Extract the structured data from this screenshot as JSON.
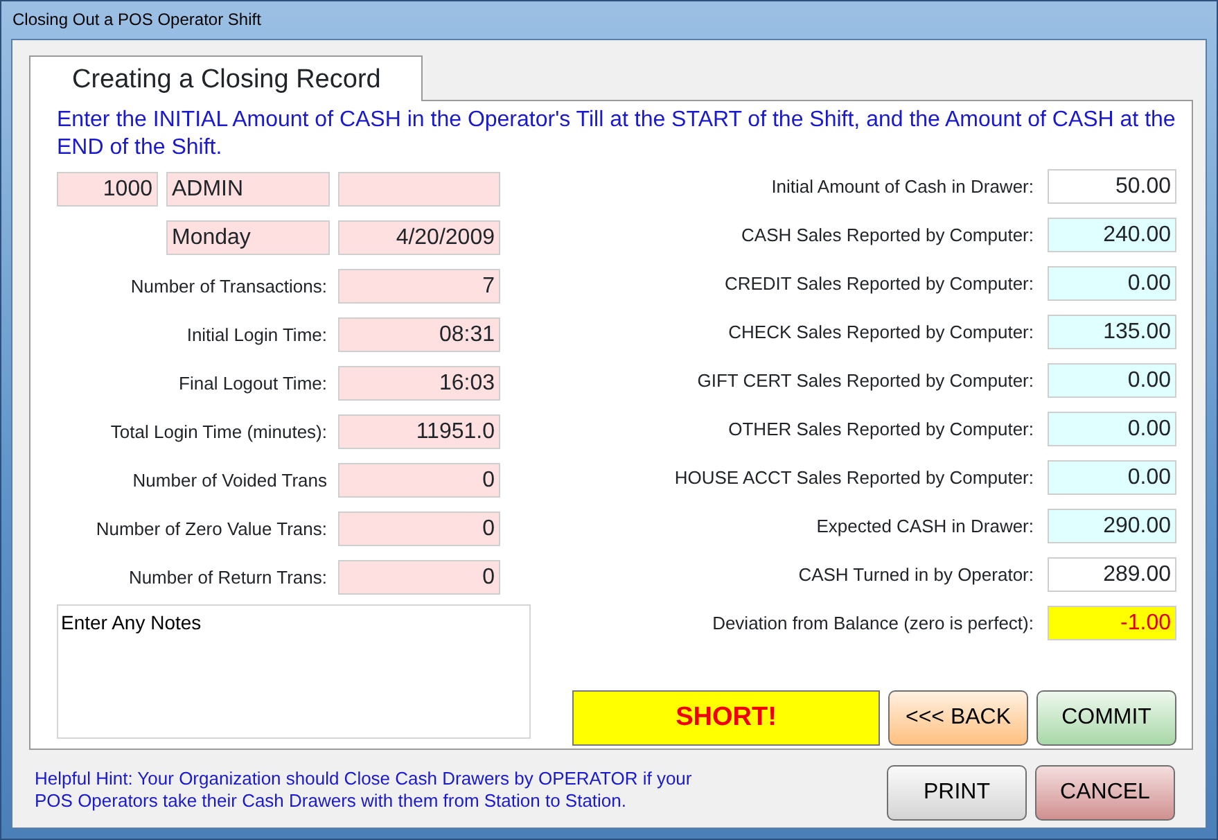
{
  "window": {
    "title": "Closing Out a POS Operator Shift"
  },
  "tab": {
    "label": "Creating a Closing Record"
  },
  "instruction": "Enter the INITIAL Amount of CASH in the Operator's Till at the START of the Shift, and the Amount of CASH at the END of the Shift.",
  "operator": {
    "id": "1000",
    "name": "ADMIN",
    "day": "Monday",
    "date": "4/20/2009"
  },
  "shift_fields": [
    {
      "label": "Number of Transactions:",
      "value": "7"
    },
    {
      "label": "Initial Login Time:",
      "value": "08:31"
    },
    {
      "label": "Final Logout Time:",
      "value": "16:03"
    },
    {
      "label": "Total Login Time (minutes):",
      "value": "11951.0"
    },
    {
      "label": "Number of Voided Trans",
      "value": "0"
    },
    {
      "label": "Number of Zero Value Trans:",
      "value": "0"
    },
    {
      "label": "Number of Return Trans:",
      "value": "0"
    }
  ],
  "notes": {
    "value": "Enter Any Notes"
  },
  "cash_fields": [
    {
      "label": "Initial Amount of Cash in Drawer:",
      "value": "50.00",
      "kind": "entry"
    },
    {
      "label": "CASH Sales Reported by Computer:",
      "value": "240.00",
      "kind": "computed"
    },
    {
      "label": "CREDIT Sales Reported by Computer:",
      "value": "0.00",
      "kind": "computed"
    },
    {
      "label": "CHECK Sales Reported by Computer:",
      "value": "135.00",
      "kind": "computed"
    },
    {
      "label": "GIFT CERT Sales Reported by Computer:",
      "value": "0.00",
      "kind": "computed"
    },
    {
      "label": "OTHER Sales Reported by Computer:",
      "value": "0.00",
      "kind": "computed"
    },
    {
      "label": "HOUSE ACCT Sales Reported by Computer:",
      "value": "0.00",
      "kind": "computed"
    },
    {
      "label": "Expected CASH in Drawer:",
      "value": "290.00",
      "kind": "computed"
    },
    {
      "label": "CASH Turned in by Operator:",
      "value": "289.00",
      "kind": "entry"
    },
    {
      "label": "Deviation from Balance (zero is perfect):",
      "value": "-1.00",
      "kind": "alert"
    }
  ],
  "status": {
    "text": "SHORT!"
  },
  "action_buttons": [
    {
      "label": "<<< BACK",
      "kind": "back"
    },
    {
      "label": "COMMIT",
      "kind": "commit"
    }
  ],
  "hint": "Helpful Hint:  Your Organization should Close Cash Drawers by OPERATOR if your POS Operators take their Cash Drawers with them from Station to Station.",
  "footer_buttons": [
    {
      "label": "PRINT",
      "kind": "print"
    },
    {
      "label": "CANCEL",
      "kind": "cancel"
    }
  ]
}
